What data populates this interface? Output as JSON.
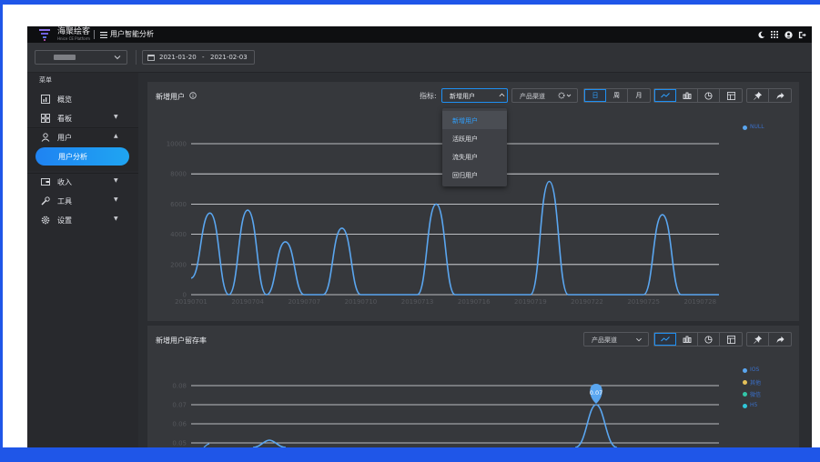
{
  "app": {
    "logo_text": "海聚绘客",
    "logo_sub": "Hnice CE Platform",
    "title": "用户智能分析"
  },
  "filters": {
    "date_start": "2021-01-20",
    "date_sep": "-",
    "date_end": "2021-02-03"
  },
  "sidebar": {
    "menu_title": "菜单",
    "items": [
      {
        "label": "概览",
        "icon": "overview-icon"
      },
      {
        "label": "看板",
        "icon": "dashboard-icon",
        "arrow": "▼"
      },
      {
        "label": "用户",
        "icon": "user-icon",
        "arrow": "▲"
      },
      {
        "label": "用户分析",
        "active": true
      },
      {
        "label": "收入",
        "icon": "wallet-icon",
        "arrow": "▼"
      },
      {
        "label": "工具",
        "icon": "tools-icon",
        "arrow": "▼"
      },
      {
        "label": "设置",
        "icon": "settings-icon",
        "arrow": "▼"
      }
    ]
  },
  "panel1": {
    "title": "新增用户",
    "metric_label": "指标:",
    "metric_value": "新增用户",
    "channel_label": "产品渠道",
    "periods": [
      "日",
      "周",
      "月"
    ],
    "active_period": "日",
    "dropdown_options": [
      "新增用户",
      "活跃用户",
      "流失用户",
      "回归用户"
    ],
    "selected_option": "新增用户",
    "legend": [
      "NULL"
    ]
  },
  "panel2": {
    "title": "新增用户留存率",
    "channel_label": "产品渠道",
    "legend": [
      "IOS",
      "其他",
      "微信",
      "H5"
    ]
  },
  "colors": {
    "accent": "#1e8ff2",
    "line": "#5aa6f0",
    "legend_colors": [
      "#5aa6f0",
      "#e5c15a",
      "#33c6a8",
      "#2fc6d8"
    ]
  },
  "chart_data": [
    {
      "type": "line",
      "title": "新增用户",
      "x": [
        "20190701",
        "20190702",
        "20190703",
        "20190704",
        "20190705",
        "20190706",
        "20190707",
        "20190708",
        "20190709",
        "20190710",
        "20190711",
        "20190712",
        "20190713",
        "20190714",
        "20190715",
        "20190716",
        "20190717",
        "20190718",
        "20190719",
        "20190720",
        "20190721",
        "20190722",
        "20190723",
        "20190724",
        "20190725",
        "20190726",
        "20190727",
        "20190728",
        "20190729"
      ],
      "xticks": [
        "20190701",
        "20190704",
        "20190707",
        "20190710",
        "20190713",
        "20190716",
        "20190719",
        "20190722",
        "20190725",
        "20190728"
      ],
      "series": [
        {
          "name": "NULL",
          "values": [
            1100,
            5400,
            0,
            5600,
            0,
            3500,
            0,
            0,
            4400,
            0,
            0,
            0,
            0,
            6000,
            0,
            0,
            0,
            0,
            0,
            7500,
            0,
            0,
            0,
            0,
            0,
            5300,
            0,
            0,
            0
          ]
        }
      ],
      "yticks": [
        0,
        2000,
        4000,
        6000,
        8000,
        10000
      ],
      "ylim": [
        0,
        10000
      ],
      "grid": true,
      "legend_position": "top-right"
    },
    {
      "type": "line",
      "title": "新增用户留存率",
      "yticks": [
        0.05,
        0.06,
        0.07,
        0.08
      ],
      "ylim": [
        0.05,
        0.085
      ],
      "annotation": "0.07",
      "legend_position": "top-right"
    }
  ]
}
